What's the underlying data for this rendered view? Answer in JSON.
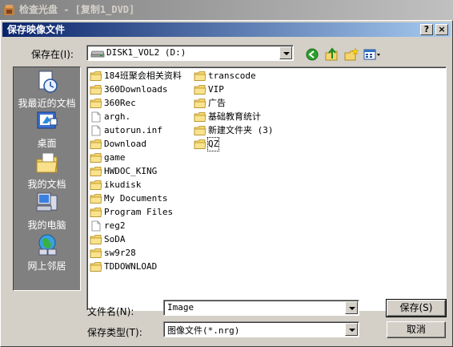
{
  "parent_window": {
    "title": "检查光盘 - [复制1_DVD]"
  },
  "dialog": {
    "title": "保存映像文件",
    "title_buttons": {
      "help": "?",
      "close": "×"
    },
    "save_in_label": "保存在(I):",
    "location": "DISK1_VOL2 (D:)",
    "places": [
      {
        "label": "我最近的文档",
        "icon": "recent-documents-icon"
      },
      {
        "label": "桌面",
        "icon": "desktop-icon"
      },
      {
        "label": "我的文档",
        "icon": "my-documents-icon"
      },
      {
        "label": "我的电脑",
        "icon": "my-computer-icon"
      },
      {
        "label": "网上邻居",
        "icon": "network-places-icon"
      }
    ],
    "files_col1": [
      {
        "name": "184班聚会相关资料",
        "type": "folder"
      },
      {
        "name": "360Downloads",
        "type": "folder"
      },
      {
        "name": "360Rec",
        "type": "folder"
      },
      {
        "name": "argh.",
        "type": "file"
      },
      {
        "name": "autorun.inf",
        "type": "file"
      },
      {
        "name": "Download",
        "type": "folder"
      },
      {
        "name": "game",
        "type": "folder"
      },
      {
        "name": "HWDOC_KING",
        "type": "folder"
      },
      {
        "name": "ikudisk",
        "type": "folder"
      },
      {
        "name": "My Documents",
        "type": "folder"
      },
      {
        "name": "Program Files",
        "type": "folder"
      },
      {
        "name": "reg2",
        "type": "file"
      },
      {
        "name": "SoDA",
        "type": "folder"
      },
      {
        "name": "sw9r28",
        "type": "folder"
      },
      {
        "name": "TDDOWNLOAD",
        "type": "folder"
      }
    ],
    "files_col2": [
      {
        "name": "transcode",
        "type": "folder"
      },
      {
        "name": "VIP",
        "type": "folder"
      },
      {
        "name": "广告",
        "type": "folder"
      },
      {
        "name": "基础教育统计",
        "type": "folder"
      },
      {
        "name": "新建文件夹 (3)",
        "type": "folder"
      },
      {
        "name": "QZ",
        "type": "folder"
      }
    ],
    "filename_label": "文件名(N):",
    "filename_value": "Image",
    "filetype_label": "保存类型(T):",
    "filetype_value": "图像文件(*.nrg)",
    "save_button": "保存(S)",
    "cancel_button": "取消"
  }
}
